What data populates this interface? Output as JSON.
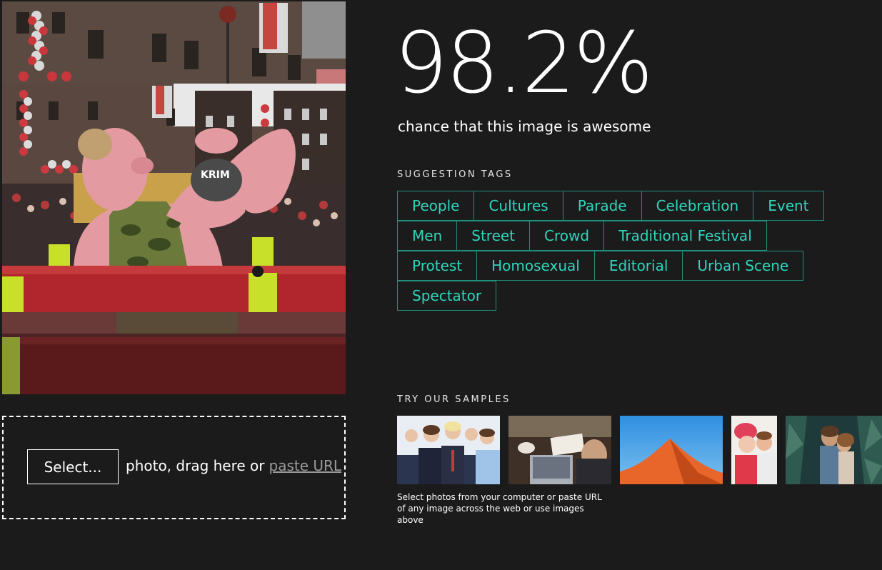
{
  "score": {
    "value": "98.2%",
    "caption": "chance that this image is awesome"
  },
  "tags_section": {
    "label": "SUGGESTION TAGS",
    "rows": [
      [
        "People",
        "Cultures",
        "Parade",
        "Celebration",
        "Event"
      ],
      [
        "Men",
        "Street",
        "Crowd",
        "Traditional Festival"
      ],
      [
        "Protest",
        "Homosexual",
        "Editorial",
        "Urban Scene"
      ],
      [
        "Spectator"
      ]
    ]
  },
  "samples_section": {
    "label": "TRY OUR SAMPLES",
    "thumbs": [
      "business-team-photo",
      "desk-laptop-photo",
      "desert-dune-photo",
      "couple-winter-photo",
      "couple-forest-photo"
    ],
    "hint": "Select photos from your computer or paste URL of any image across the web or use images above"
  },
  "upload": {
    "select_label": "Select...",
    "text": "photo, drag here or",
    "paste_label": "paste URL"
  },
  "preview": {
    "sign_text": "KRIM"
  },
  "colors": {
    "background": "#1b1b1b",
    "tag_border": "#1f8f7f",
    "tag_text": "#2fd6bd"
  }
}
